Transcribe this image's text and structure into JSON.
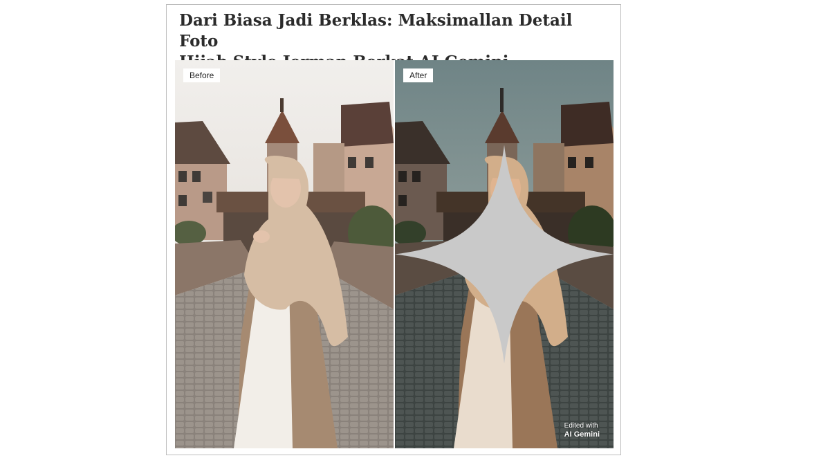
{
  "article": {
    "title_line1": "Dari Biasa Jadi Berklas: Maksimallan Detail Foto",
    "title_line2": "Hijab Style Jerman Berkat AI Gemini"
  },
  "comparison": {
    "before_label": "Before",
    "after_label": "After",
    "watermark_line1": "Edited with",
    "watermark_line2": "AI Gemini",
    "watermark_icon": "sparkle-icon"
  },
  "colors": {
    "before_sky": "#e9e6e2",
    "after_sky": "#7d8f92",
    "hijab": "#d6bda4",
    "coat": "#a88b72",
    "dress": "#f1ede6"
  }
}
